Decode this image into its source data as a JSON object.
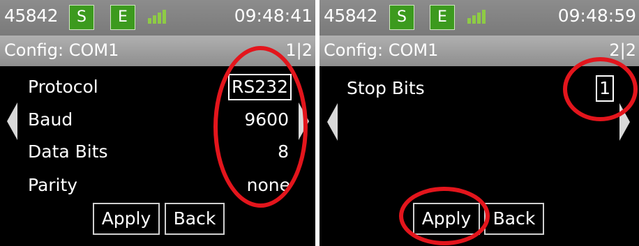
{
  "screens": [
    {
      "status": {
        "device_id": "45842",
        "badge_s": "S",
        "badge_e": "E",
        "time": "09:48:41"
      },
      "title": {
        "text": "Config: COM1",
        "page": "1|2"
      },
      "rows": [
        {
          "label": "Protocol",
          "value": "RS232"
        },
        {
          "label": "Baud",
          "value": "9600"
        },
        {
          "label": "Data Bits",
          "value": "8"
        },
        {
          "label": "Parity",
          "value": "none"
        }
      ],
      "buttons": {
        "apply": "Apply",
        "back": "Back"
      }
    },
    {
      "status": {
        "device_id": "45842",
        "badge_s": "S",
        "badge_e": "E",
        "time": "09:48:59"
      },
      "title": {
        "text": "Config: COM1",
        "page": "2|2"
      },
      "rows": [
        {
          "label": "Stop Bits",
          "value": "1"
        }
      ],
      "buttons": {
        "apply": "Apply",
        "back": "Back"
      }
    }
  ],
  "icons": {
    "signal": "signal-strength-icon",
    "nav_left": "chevron-left-icon",
    "nav_right": "chevron-right-icon"
  },
  "colors": {
    "badge_green": "#3c9a1e",
    "signal_green": "#8ecb45",
    "annotation_red": "#e3151c",
    "status_bar_gray": "#8c8c8c"
  }
}
